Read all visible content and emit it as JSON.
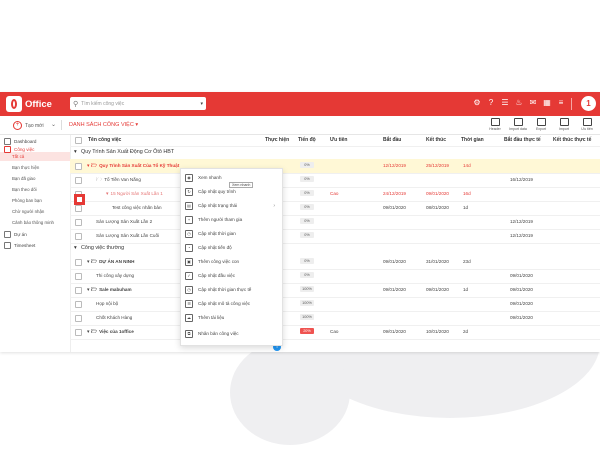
{
  "app": {
    "logo_text": "Office"
  },
  "search": {
    "placeholder": "Tìm kiếm công việc"
  },
  "header_icons": [
    "settings-icon",
    "help-icon",
    "chat-icon",
    "bell-icon",
    "mail-icon",
    "apps-icon",
    "menu-icon"
  ],
  "user": {
    "avatar": "1"
  },
  "toolbar": {
    "create_label": "Tạo mới",
    "list_label": "DANH SÁCH CÔNG VIỆC",
    "tools": [
      {
        "icon": "header-icon",
        "label": "Header"
      },
      {
        "icon": "import-icon",
        "label": "Import data"
      },
      {
        "icon": "export-icon",
        "label": "Export"
      },
      {
        "icon": "import-icon",
        "label": "Import"
      },
      {
        "icon": "filter-icon",
        "label": "Ưu tiên"
      }
    ]
  },
  "sidebar": {
    "dashboard": "Dashboard",
    "tasks": "Công việc",
    "tasks_children": [
      "Tất cả",
      "Bạn thực hiện",
      "Bạn đã giao",
      "Bạn theo dõi",
      "Phòng ban bạn",
      "Chờ người nhận",
      "Cảnh báo thông minh"
    ],
    "projects": "Dự án",
    "timesheet": "Timesheet"
  },
  "table": {
    "headers": {
      "name": "Tên công việc",
      "performer": "Thực hiện",
      "progress": "Tiến độ",
      "priority": "Ưu tiên",
      "start": "Bắt đầu",
      "end": "Kết thúc",
      "duration": "Thời gian",
      "actual_start": "Bắt đầu thực tế",
      "actual_end": "Kết thúc thực tế"
    },
    "group1": "Quy Trình Sản Xuất Động Cơ Ôtô HBT",
    "rows1": [
      {
        "name": "Quy Trình Sản Xuất Của Tổ Kỹ Thuật",
        "progress": "0%",
        "priority": "",
        "start": "12/12/2019",
        "end": "25/12/2019",
        "duration": "14d",
        "actual_start": "",
        "actual_end": ""
      },
      {
        "name": "Tổ Tiền Van Nắng",
        "progress": "0%",
        "priority": "",
        "start": "",
        "end": "",
        "duration": "",
        "actual_start": "16/12/2019",
        "actual_end": ""
      },
      {
        "name": "15 Người Sản Xuất Lần 1",
        "progress": "0%",
        "priority": "Cao",
        "start": "24/12/2019",
        "end": "09/01/2020",
        "duration": "16d",
        "actual_start": "",
        "actual_end": ""
      },
      {
        "name": "Test công việc nhãn bản",
        "progress": "0%",
        "priority": "",
        "start": "09/01/2020",
        "end": "08/01/2020",
        "duration": "1d",
        "actual_start": "",
        "actual_end": ""
      },
      {
        "name": "Sản Lượng Sản Xuất Lần 2",
        "progress": "0%",
        "priority": "",
        "start": "",
        "end": "",
        "duration": "",
        "actual_start": "12/12/2019",
        "actual_end": ""
      },
      {
        "name": "Sản Lượng Sản Xuất Lần Cuối",
        "progress": "0%",
        "priority": "",
        "start": "",
        "end": "",
        "duration": "",
        "actual_start": "12/12/2019",
        "actual_end": ""
      }
    ],
    "group2": "Công việc thường",
    "rows2": [
      {
        "name": "DỰ ÁN AN NINH",
        "progress": "0%",
        "priority": "",
        "start": "09/01/2020",
        "end": "31/01/2020",
        "duration": "23d",
        "actual_start": "",
        "actual_end": ""
      },
      {
        "name": "Thi công xây dựng",
        "progress": "0%",
        "priority": "",
        "start": "",
        "end": "",
        "duration": "",
        "actual_start": "09/01/2020",
        "actual_end": ""
      },
      {
        "name": "Sale mabuham",
        "progress": "100%",
        "priority": "",
        "start": "09/01/2020",
        "end": "09/01/2020",
        "duration": "1d",
        "actual_start": "09/01/2020",
        "actual_end": ""
      },
      {
        "name": "Họp nội bộ",
        "progress": "100%",
        "priority": "",
        "start": "",
        "end": "",
        "duration": "",
        "actual_start": "09/01/2020",
        "actual_end": ""
      },
      {
        "name": "Chốt Khách Hàng",
        "progress": "100%",
        "priority": "",
        "start": "",
        "end": "",
        "duration": "",
        "actual_start": "09/01/2020",
        "actual_end": ""
      },
      {
        "name": "Việc của 1office",
        "progress": "20%",
        "priority": "Cao",
        "start": "09/01/2020",
        "end": "10/01/2020",
        "duration": "2d",
        "actual_start": "",
        "actual_end": ""
      }
    ]
  },
  "context_menu": {
    "items": [
      "Xem nhanh",
      "Cập nhật quy trình",
      "Cập nhật trạng thái",
      "Thêm người tham gia",
      "Cập nhật thời gian",
      "Cập nhật tiến độ",
      "Thêm công việc con",
      "Cập nhật đầu việc",
      "Cập nhật thời gian thực tế",
      "Cập nhật mô tả công việc",
      "Thêm tài liệu",
      "Nhân bản công việc"
    ],
    "tooltip": "Xem nhanh"
  },
  "colors": {
    "brand": "#e53935",
    "highlight": "#fff8d6"
  }
}
